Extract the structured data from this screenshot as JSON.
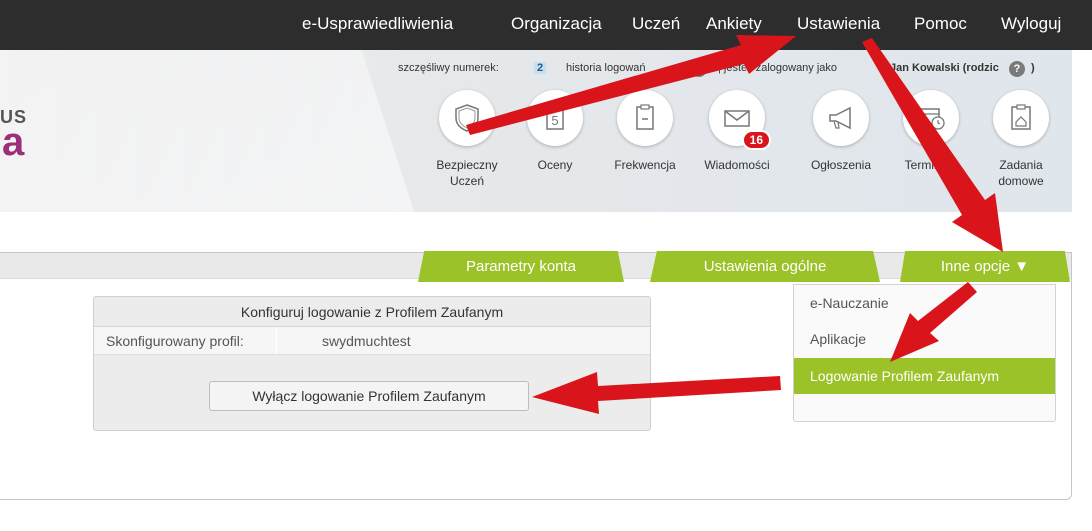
{
  "nav": {
    "items": [
      "e-Usprawiedliwienia",
      "Organizacja",
      "Uczeń",
      "Ankiety",
      "Ustawienia",
      "Pomoc",
      "Wyloguj"
    ]
  },
  "logo": {
    "line1": "US",
    "line2": "a"
  },
  "infobar": {
    "lucky_label": "szczęśliwy numerek:",
    "lucky_number": "2",
    "history_label": "historia logowań",
    "logged_label": "| jesteś zalogowany jako",
    "user": "Jan Kowalski (rodzic",
    "close": ")"
  },
  "tiles": [
    {
      "label": "Bezpieczny Uczeń",
      "icon": "shield-icon"
    },
    {
      "label": "Oceny",
      "icon": "grades-icon"
    },
    {
      "label": "Frekwencja",
      "icon": "attendance-icon"
    },
    {
      "label": "Wiadomości",
      "icon": "envelope-icon",
      "badge": "16"
    },
    {
      "label": "Ogłoszenia",
      "icon": "megaphone-icon"
    },
    {
      "label": "Terminarz",
      "icon": "calendar-icon"
    },
    {
      "label": "Zadania domowe",
      "icon": "homework-icon"
    }
  ],
  "tabs": {
    "account": "Parametry konta",
    "general": "Ustawienia ogólne",
    "other": "Inne opcje ▼"
  },
  "config": {
    "title": "Konfiguruj logowanie z Profilem Zaufanym",
    "profile_label": "Skonfigurowany profil:",
    "profile_value": "swydmuchtest",
    "disable_button": "Wyłącz logowanie Profilem Zaufanym"
  },
  "dropdown": {
    "items": [
      "e-Nauczanie",
      "Aplikacje",
      "Logowanie Profilem Zaufanym"
    ],
    "active_index": 2
  },
  "colors": {
    "accent_green": "#9cc229",
    "arrow_red": "#d9141b",
    "topbar": "#2d2d2d"
  }
}
